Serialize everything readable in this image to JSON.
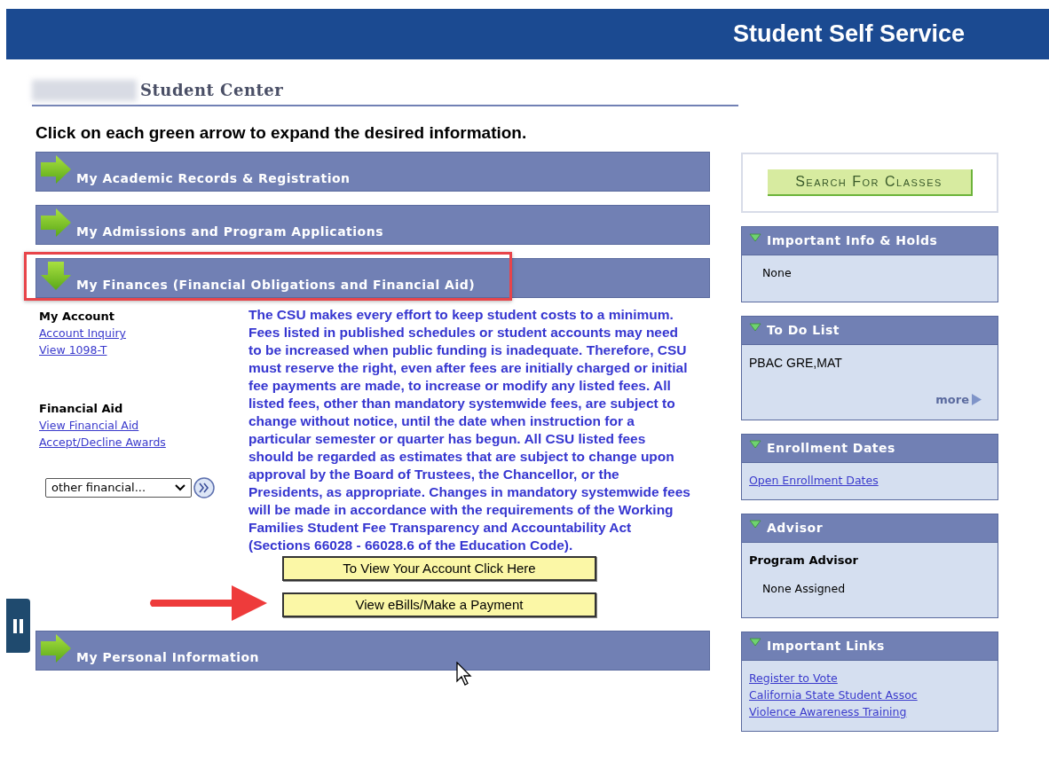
{
  "header": {
    "title": "Student Self Service"
  },
  "page_title": "Student Center",
  "instruction": "Click on each green arrow to expand the desired information.",
  "sections": [
    {
      "title": "My Academic Records & Registration",
      "expanded": false,
      "highlighted": false
    },
    {
      "title": "My Admissions and Program Applications",
      "expanded": false,
      "highlighted": false
    },
    {
      "title": "My Finances (Financial Obligations and Financial Aid)",
      "expanded": true,
      "highlighted": true,
      "groups": [
        {
          "heading": "My Account",
          "links": [
            "Account Inquiry",
            "View 1098-T"
          ]
        },
        {
          "heading": "Financial Aid",
          "links": [
            "View Financial Aid",
            "Accept/Decline Awards"
          ]
        }
      ],
      "select": {
        "value": "other financial..."
      },
      "notice": "The CSU makes every effort to keep student costs to a minimum. Fees listed in published schedules or student accounts may need to be increased when public funding is inadequate. Therefore, CSU must reserve the right, even after fees are initially charged or initial fee payments are made, to increase or modify any listed fees. All listed fees, other than mandatory systemwide fees, are subject to change without notice, until the date when instruction for a particular semester or quarter has begun. All CSU listed fees should be regarded as estimates that are subject to change upon approval by the Board of Trustees, the Chancellor, or the Presidents, as appropriate. Changes in mandatory systemwide fees will be made in accordance with the requirements of the Working Families Student Fee Transparency and Accountability Act (Sections 66028 - 66028.6 of the Education Code).",
      "buttons": [
        {
          "label": "To View Your Account Click Here",
          "pointed": false
        },
        {
          "label": "View eBills/Make a Payment",
          "pointed": true
        }
      ]
    },
    {
      "title": "My Personal Information",
      "expanded": false,
      "highlighted": false
    }
  ],
  "search_button": "Search For Classes",
  "panels": [
    {
      "title": "Important Info & Holds",
      "expanded": true,
      "items": [
        {
          "kind": "indented",
          "text": "None"
        }
      ]
    },
    {
      "title": "To Do List",
      "expanded": true,
      "items": [
        {
          "kind": "text",
          "text": "PBAC GRE,MAT"
        }
      ],
      "more": "more"
    },
    {
      "title": "Enrollment Dates",
      "expanded": true,
      "items": [
        {
          "kind": "link",
          "text": "Open Enrollment Dates"
        }
      ]
    },
    {
      "title": "Advisor",
      "expanded": true,
      "items": [
        {
          "kind": "heading",
          "text": "Program Advisor"
        },
        {
          "kind": "indented",
          "text": "None Assigned"
        }
      ]
    },
    {
      "title": "Important Links",
      "expanded": true,
      "items": [
        {
          "kind": "link",
          "text": "Register to Vote"
        },
        {
          "kind": "link",
          "text": "California State Student Assoc"
        },
        {
          "kind": "link",
          "text": "Violence Awareness Training"
        }
      ]
    }
  ]
}
